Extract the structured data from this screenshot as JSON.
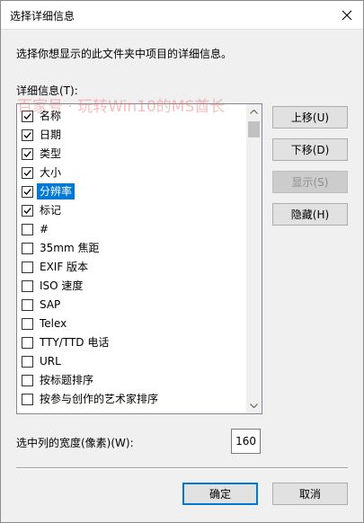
{
  "window": {
    "title": "选择详细信息"
  },
  "description": "选择你想显示的此文件夹中项目的详细信息。",
  "list_label": "详细信息(T):",
  "watermark": "百家号 · 玩转Win10的MS酋长",
  "items": [
    {
      "label": "名称",
      "checked": true,
      "selected": false
    },
    {
      "label": "日期",
      "checked": true,
      "selected": false
    },
    {
      "label": "类型",
      "checked": true,
      "selected": false
    },
    {
      "label": "大小",
      "checked": true,
      "selected": false
    },
    {
      "label": "分辨率",
      "checked": true,
      "selected": true
    },
    {
      "label": "标记",
      "checked": true,
      "selected": false
    },
    {
      "label": "#",
      "checked": false,
      "selected": false
    },
    {
      "label": "35mm 焦距",
      "checked": false,
      "selected": false
    },
    {
      "label": "EXIF 版本",
      "checked": false,
      "selected": false
    },
    {
      "label": "ISO 速度",
      "checked": false,
      "selected": false
    },
    {
      "label": "SAP",
      "checked": false,
      "selected": false
    },
    {
      "label": "Telex",
      "checked": false,
      "selected": false
    },
    {
      "label": "TTY/TTD 电话",
      "checked": false,
      "selected": false
    },
    {
      "label": "URL",
      "checked": false,
      "selected": false
    },
    {
      "label": "按标题排序",
      "checked": false,
      "selected": false
    },
    {
      "label": "按参与创作的艺术家排序",
      "checked": false,
      "selected": false
    }
  ],
  "buttons": {
    "move_up": "上移(U)",
    "move_down": "下移(D)",
    "show": "显示(S)",
    "hide": "隐藏(H)",
    "ok": "确定",
    "cancel": "取消"
  },
  "width_field": {
    "label": "选中列的宽度(像素)(W):",
    "value": "160"
  },
  "colors": {
    "selection": "#0078d7",
    "dialog_bg": "#f0f0f0",
    "watermark": "#eb6e6e"
  },
  "icons": {
    "close": "close-icon",
    "checkbox": "checkmark-icon",
    "scroll_up": "scroll-up-arrow-icon",
    "scroll_down": "scroll-down-arrow-icon"
  }
}
